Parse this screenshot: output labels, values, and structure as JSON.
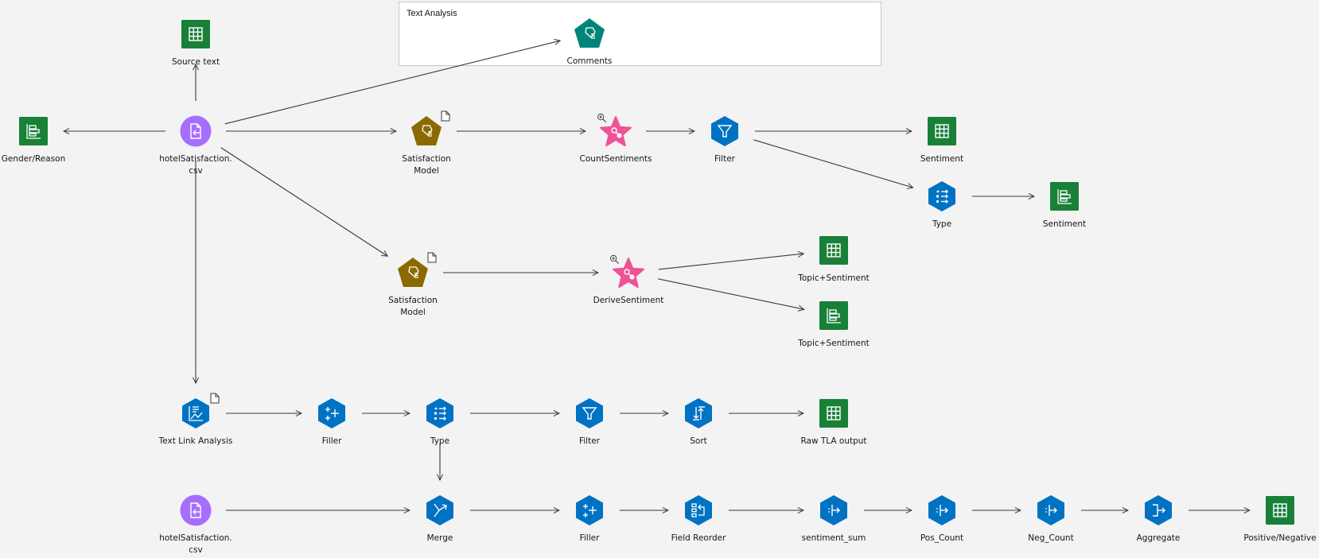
{
  "supernode": {
    "title": "Text Analysis"
  },
  "colors": {
    "table": "#198038",
    "process": "#0f62fe",
    "hex": "#0072c3",
    "source": "#8a3ffc",
    "source_fill": "#a56eff",
    "model": "#8a6a00",
    "model_text": "#00857a",
    "star": "#ee5396",
    "edge": "#393939",
    "background": "#f3f3f3"
  },
  "nodes": [
    {
      "id": "source_text",
      "label": "Source text",
      "type": "table",
      "icon": "table-icon"
    },
    {
      "id": "gender_reason",
      "label": "Gender/Reason",
      "type": "chart",
      "icon": "bar-chart-icon"
    },
    {
      "id": "hotel_csv_1",
      "label": "hotelSatisfaction.\ncsv",
      "type": "source",
      "icon": "file-import-icon"
    },
    {
      "id": "comments",
      "label": "Comments",
      "type": "model-teal",
      "icon": "text-model-icon"
    },
    {
      "id": "sat_model_1",
      "label": "Satisfaction\nModel",
      "type": "model",
      "icon": "text-model-icon",
      "badge": "document-icon"
    },
    {
      "id": "count_sentiments",
      "label": "CountSentiments",
      "type": "star",
      "icon": "query-star-icon",
      "badge": "zoom-in-icon"
    },
    {
      "id": "filter_1",
      "label": "Filter",
      "type": "hex",
      "icon": "filter-icon"
    },
    {
      "id": "sentiment_table",
      "label": "Sentiment",
      "type": "table",
      "icon": "table-icon"
    },
    {
      "id": "type_1",
      "label": "Type",
      "type": "hex",
      "icon": "type-icon"
    },
    {
      "id": "sentiment_chart",
      "label": "Sentiment",
      "type": "chart",
      "icon": "bar-chart-icon"
    },
    {
      "id": "sat_model_2",
      "label": "Satisfaction\nModel",
      "type": "model",
      "icon": "text-model-icon",
      "badge": "document-icon"
    },
    {
      "id": "derive_sentiment",
      "label": "DeriveSentiment",
      "type": "star",
      "icon": "query-star-icon",
      "badge": "zoom-in-icon"
    },
    {
      "id": "topic_table",
      "label": "Topic+Sentiment",
      "type": "table",
      "icon": "table-icon"
    },
    {
      "id": "topic_chart",
      "label": "Topic+Sentiment",
      "type": "chart",
      "icon": "bar-chart-icon"
    },
    {
      "id": "tla",
      "label": "Text Link Analysis",
      "type": "hex",
      "icon": "text-link-analysis-icon",
      "badge": "document-icon"
    },
    {
      "id": "filler_1",
      "label": "Filler",
      "type": "hex",
      "icon": "filler-icon"
    },
    {
      "id": "type_2",
      "label": "Type",
      "type": "hex",
      "icon": "type-icon"
    },
    {
      "id": "filter_2",
      "label": "Filter",
      "type": "hex",
      "icon": "filter-icon"
    },
    {
      "id": "sort",
      "label": "Sort",
      "type": "hex",
      "icon": "sort-icon"
    },
    {
      "id": "raw_tla",
      "label": "Raw TLA output",
      "type": "table",
      "icon": "table-icon"
    },
    {
      "id": "hotel_csv_2",
      "label": "hotelSatisfaction.\ncsv",
      "type": "source",
      "icon": "file-import-icon"
    },
    {
      "id": "merge",
      "label": "Merge",
      "type": "hex",
      "icon": "merge-icon"
    },
    {
      "id": "filler_2",
      "label": "Filler",
      "type": "hex",
      "icon": "filler-icon"
    },
    {
      "id": "field_reorder",
      "label": "Field Reorder",
      "type": "hex",
      "icon": "field-reorder-icon"
    },
    {
      "id": "sentiment_sum",
      "label": "sentiment_sum",
      "type": "hex",
      "icon": "derive-icon"
    },
    {
      "id": "pos_count",
      "label": "Pos_Count",
      "type": "hex",
      "icon": "derive-icon"
    },
    {
      "id": "neg_count",
      "label": "Neg_Count",
      "type": "hex",
      "icon": "derive-icon"
    },
    {
      "id": "aggregate",
      "label": "Aggregate",
      "type": "hex",
      "icon": "aggregate-icon"
    },
    {
      "id": "pos_neg",
      "label": "Positive/Negative",
      "type": "table",
      "icon": "table-icon"
    }
  ],
  "edges": [
    [
      "hotel_csv_1",
      "source_text"
    ],
    [
      "hotel_csv_1",
      "gender_reason"
    ],
    [
      "hotel_csv_1",
      "comments"
    ],
    [
      "hotel_csv_1",
      "sat_model_1"
    ],
    [
      "hotel_csv_1",
      "sat_model_2"
    ],
    [
      "hotel_csv_1",
      "tla"
    ],
    [
      "sat_model_1",
      "count_sentiments"
    ],
    [
      "count_sentiments",
      "filter_1"
    ],
    [
      "filter_1",
      "sentiment_table"
    ],
    [
      "filter_1",
      "type_1"
    ],
    [
      "type_1",
      "sentiment_chart"
    ],
    [
      "sat_model_2",
      "derive_sentiment"
    ],
    [
      "derive_sentiment",
      "topic_table"
    ],
    [
      "derive_sentiment",
      "topic_chart"
    ],
    [
      "tla",
      "filler_1"
    ],
    [
      "filler_1",
      "type_2"
    ],
    [
      "type_2",
      "filter_2"
    ],
    [
      "filter_2",
      "sort"
    ],
    [
      "sort",
      "raw_tla"
    ],
    [
      "type_2",
      "merge"
    ],
    [
      "hotel_csv_2",
      "merge"
    ],
    [
      "merge",
      "filler_2"
    ],
    [
      "filler_2",
      "field_reorder"
    ],
    [
      "field_reorder",
      "sentiment_sum"
    ],
    [
      "sentiment_sum",
      "pos_count"
    ],
    [
      "pos_count",
      "neg_count"
    ],
    [
      "neg_count",
      "aggregate"
    ],
    [
      "aggregate",
      "pos_neg"
    ]
  ]
}
